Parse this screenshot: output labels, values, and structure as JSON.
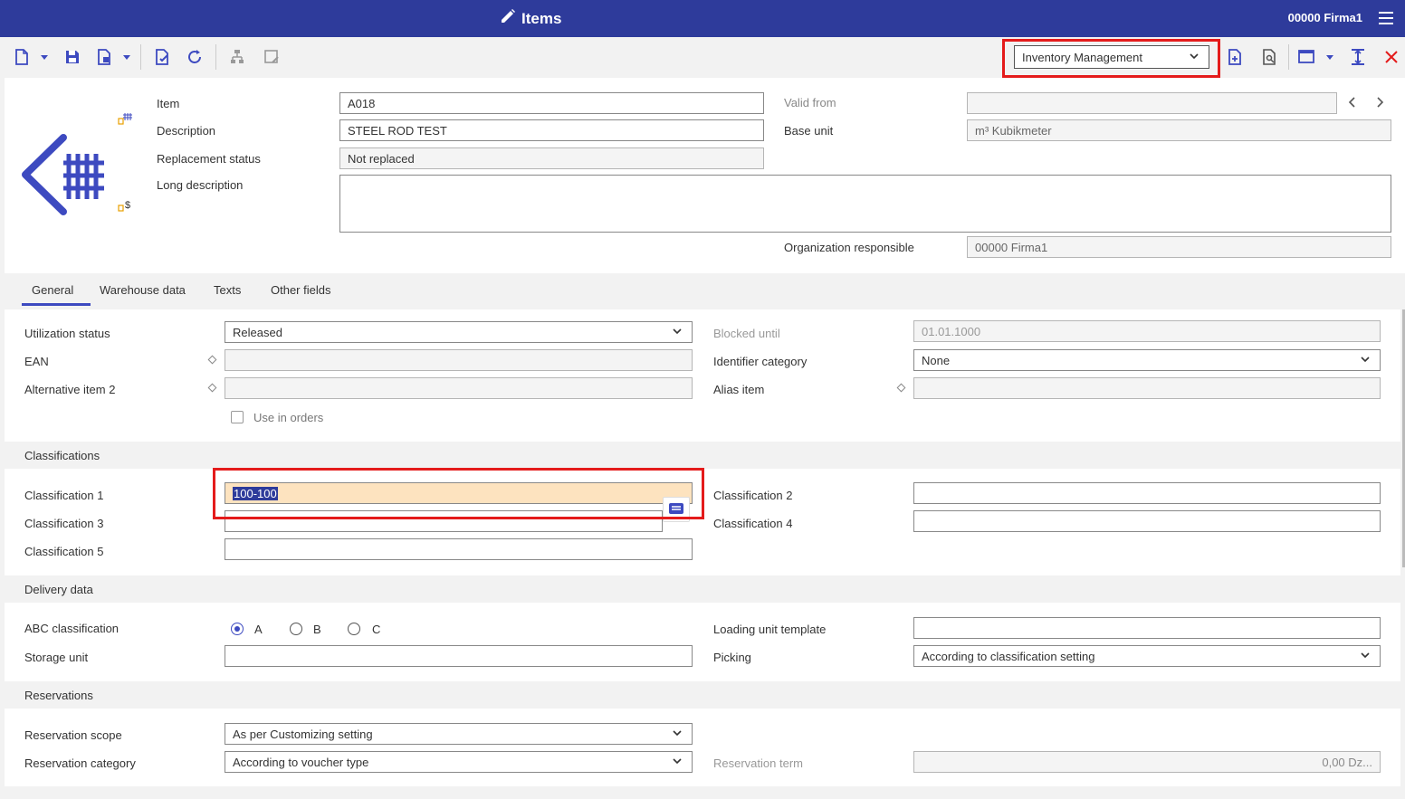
{
  "app": {
    "title": "Items",
    "org": "00000  Firma1"
  },
  "toolbar": {
    "context": "Inventory Management"
  },
  "header": {
    "item_label": "Item",
    "item_value": "A018",
    "description_label": "Description",
    "description_value": "STEEL ROD TEST",
    "replacement_label": "Replacement status",
    "replacement_value": "Not replaced",
    "longdesc_label": "Long description",
    "validfrom_label": "Valid from",
    "baseunit_label": "Base unit",
    "baseunit_value": "m³ Kubikmeter",
    "org_label": "Organization responsible",
    "org_value": "00000 Firma1"
  },
  "tabs": [
    {
      "label": "General"
    },
    {
      "label": "Warehouse data"
    },
    {
      "label": "Texts"
    },
    {
      "label": "Other fields"
    }
  ],
  "general": {
    "utilization_label": "Utilization status",
    "utilization_value": "Released",
    "ean_label": "EAN",
    "alt_item_label": "Alternative item 2",
    "use_in_orders_label": "Use in orders",
    "blocked_label": "Blocked until",
    "blocked_value": "01.01.1000",
    "identifier_label": "Identifier category",
    "identifier_value": "None",
    "alias_label": "Alias item"
  },
  "classifications": {
    "title": "Classifications",
    "c1_label": "Classification 1",
    "c1_value": "100-100",
    "c2_label": "Classification 2",
    "c3_label": "Classification 3",
    "c4_label": "Classification 4",
    "c5_label": "Classification 5"
  },
  "delivery": {
    "title": "Delivery data",
    "abc_label": "ABC classification",
    "abc_options": [
      "A",
      "B",
      "C"
    ],
    "abc_selected": "A",
    "storage_label": "Storage unit",
    "loading_label": "Loading unit template",
    "picking_label": "Picking",
    "picking_value": "According to classification setting"
  },
  "reservations": {
    "title": "Reservations",
    "scope_label": "Reservation scope",
    "scope_value": "As per Customizing setting",
    "category_label": "Reservation category",
    "category_value": "According to voucher type",
    "term_label": "Reservation term",
    "term_value": "0,00 Dz..."
  },
  "colors": {
    "brand": "#2e3b9b",
    "accent": "#3d4ac0",
    "highlight": "#e41b1b"
  }
}
